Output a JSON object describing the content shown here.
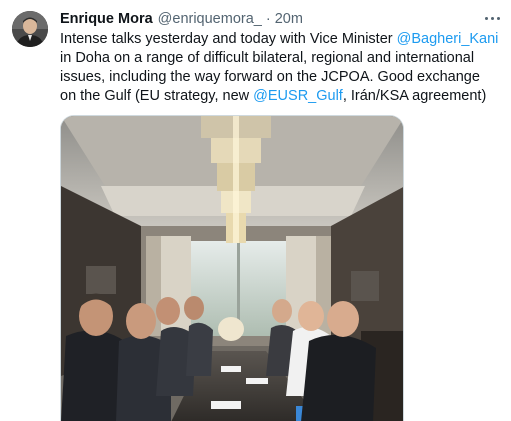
{
  "author": {
    "display_name": "Enrique Mora",
    "handle": "@enriquemora_",
    "separator": "·",
    "time": "20m"
  },
  "tweet": {
    "t1": "Intense talks yesterday and today with Vice Minister ",
    "m1": "@Bagheri_Kani",
    "t2": " in Doha on a range of difficult bilateral, regional and international issues, including the way forward on the JCPOA. Good exchange on the Gulf (EU strategy, new ",
    "m2": "@EUSR_Gulf",
    "t3": ", Irán/KSA agreement)"
  },
  "colors": {
    "link": "#1d9bf0",
    "text": "#0f1419",
    "secondary": "#536471"
  },
  "icons": {
    "avatar": "profile-photo",
    "more": "more-options-icon",
    "media": "meeting-photo"
  }
}
